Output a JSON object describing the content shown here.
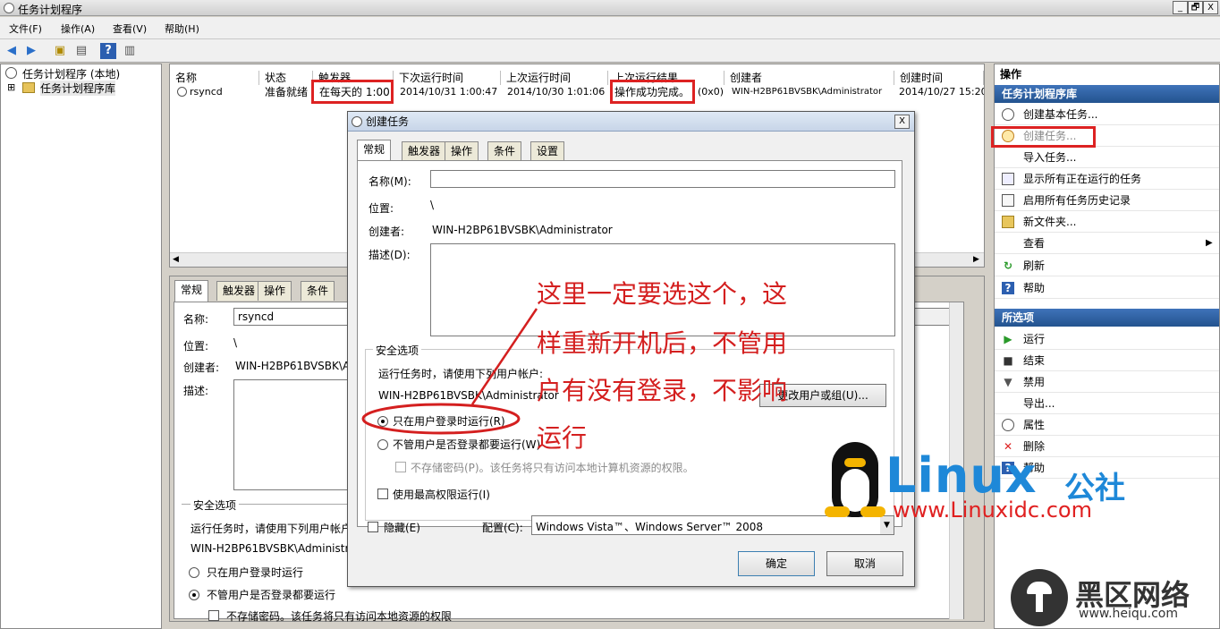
{
  "window": {
    "title": "任务计划程序",
    "minimize": "_",
    "restore": "🗗",
    "close": "X"
  },
  "menu": [
    "文件(F)",
    "操作(A)",
    "查看(V)",
    "帮助(H)"
  ],
  "tree": {
    "root": "任务计划程序 (本地)",
    "expand_glyph": "⊞",
    "library": "任务计划程序库"
  },
  "grid": {
    "columns": [
      "名称",
      "状态",
      "触发器",
      "下次运行时间",
      "上次运行时间",
      "上次运行结果",
      "创建者",
      "创建时间"
    ],
    "row": {
      "name": "rsyncd",
      "status": "准备就绪",
      "trigger": "在每天的 1:00",
      "next_run": "2014/10/31 1:00:47",
      "last_run": "2014/10/30 1:01:06",
      "result": "操作成功完成。",
      "result_code": "(0x0)",
      "author": "WIN-H2BP61BVSBK\\Administrator",
      "created": "2014/10/27 15:20"
    }
  },
  "detail": {
    "tabs": [
      "常规",
      "触发器",
      "操作",
      "条件"
    ],
    "name_label": "名称:",
    "name_value": "rsyncd",
    "location_label": "位置:",
    "location_value": "\\",
    "author_label": "创建者:",
    "author_value": "WIN-H2BP61BVSBK\\A",
    "desc_label": "描述:",
    "security": {
      "title": "安全选项",
      "run_as": "运行任务时，请使用下列用户帐户",
      "user": "WIN-H2BP61BVSBK\\Administr",
      "opt1": "只在用户登录时运行",
      "opt2": "不管用户是否登录都要运行",
      "opt3": "不存储密码。该任务将只有访问本地资源的权限"
    }
  },
  "actions": {
    "header": "操作",
    "library_title": "任务计划程序库",
    "items": [
      "创建基本任务...",
      "创建任务...",
      "导入任务...",
      "显示所有正在运行的任务",
      "启用所有任务历史记录",
      "新文件夹...",
      "查看",
      "刷新",
      "帮助"
    ],
    "view_arrow": "▶",
    "selected_title": "所选项",
    "selected": [
      "运行",
      "结束",
      "禁用",
      "导出...",
      "属性",
      "删除",
      "帮助"
    ]
  },
  "dialog": {
    "title": "创建任务",
    "close": "X",
    "tabs": [
      "常规",
      "触发器",
      "操作",
      "条件",
      "设置"
    ],
    "name_label": "名称(M):",
    "name_value": "",
    "location_label": "位置:",
    "location_value": "\\",
    "author_label": "创建者:",
    "author_value": "WIN-H2BP61BVSBK\\Administrator",
    "desc_label": "描述(D):",
    "security_title": "安全选项",
    "run_as": "运行任务时，请使用下列用户帐户:",
    "user": "WIN-H2BP61BVSBK\\Administrator",
    "change_button": "更改用户或组(U)...",
    "opt_logged_on": "只在用户登录时运行(R)",
    "opt_whether": "不管用户是否登录都要运行(W)",
    "opt_nopwd": "不存储密码(P)。该任务将只有访问本地计算机资源的权限。",
    "opt_highest": "使用最高权限运行(I)",
    "hidden_label": "隐藏(E)",
    "config_label": "配置(C):",
    "config_value": "Windows Vista™、Windows Server™ 2008",
    "ok": "确定",
    "cancel": "取消"
  },
  "annotation": {
    "lines": [
      "这里一定要选这个，这",
      "样重新开机后，不管用",
      "户有没有登录，不影响",
      "运行"
    ],
    "color": "#d41f1f"
  },
  "watermark": {
    "brand_main": "Linux",
    "brand_cn": "公社",
    "url": "www.Linuxidc.com",
    "site2_cn": "黑区网络",
    "site2_url": "www.heiqu.com"
  }
}
